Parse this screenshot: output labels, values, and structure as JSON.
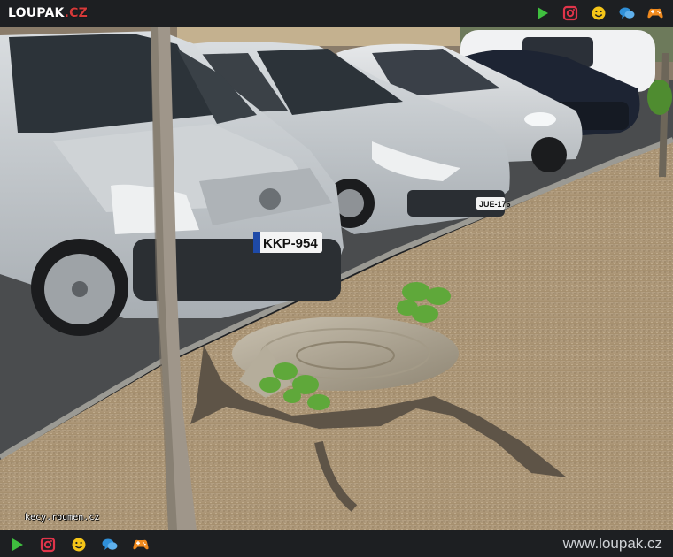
{
  "header": {
    "logo_text": "LOUPAK",
    "logo_dot": ".",
    "logo_tld": "CZ"
  },
  "nav_icons": [
    "play-icon",
    "instagram-icon",
    "smiley-icon",
    "chat-icon",
    "gamepad-icon"
  ],
  "colors": {
    "bar_background": "#1d1f22",
    "play_green": "#3fbf3f",
    "instagram_red": "#e0344a",
    "smiley_yellow": "#f5c518",
    "chat_blue": "#2f8fd8",
    "gamepad_orange": "#f08a1e"
  },
  "photo": {
    "watermark": "kecy.roumen.cz",
    "license_plate_front": "KKP-954",
    "license_plate_second": "JUE-176"
  },
  "footer": {
    "site_url": "www.loupak.cz"
  }
}
